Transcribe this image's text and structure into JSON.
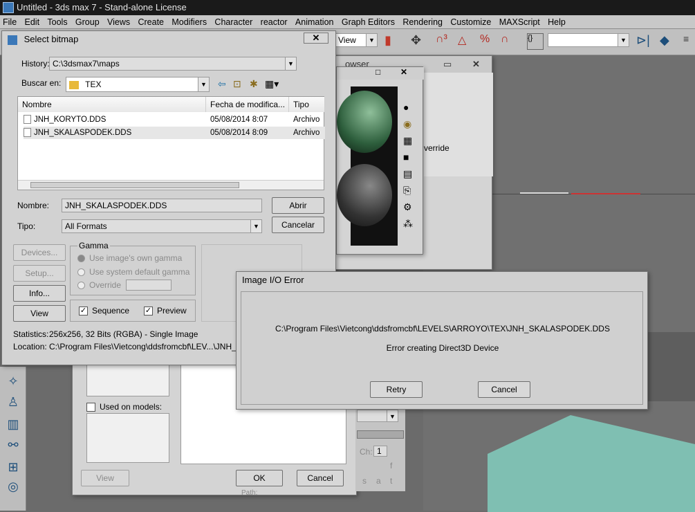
{
  "app": {
    "title": "Untitled - 3ds max 7 - Stand-alone License",
    "menu": [
      "File",
      "Edit",
      "Tools",
      "Group",
      "Views",
      "Create",
      "Modifiers",
      "Character",
      "reactor",
      "Animation",
      "Graph Editors",
      "Rendering",
      "Customize",
      "MAXScript",
      "Help"
    ],
    "toolbar_view_label": "View"
  },
  "select_bitmap": {
    "title": "Select bitmap",
    "history_label": "History:",
    "history_value": "C:\\3dsmax7\\maps",
    "lookin_label": "Buscar en:",
    "lookin_value": "TEX",
    "columns": [
      "Nombre",
      "Fecha de modifica...",
      "Tipo"
    ],
    "files": [
      {
        "name": "JNH_KORYTO.DDS",
        "date": "05/08/2014 8:07",
        "type": "Archivo"
      },
      {
        "name": "JNH_SKALASPODEK.DDS",
        "date": "05/08/2014 8:09",
        "type": "Archivo"
      }
    ],
    "name_label": "Nombre:",
    "name_value": "JNH_SKALASPODEK.DDS",
    "type_label": "Tipo:",
    "type_value": "All Formats",
    "open_button": "Abrir",
    "cancel_button": "Cancelar",
    "devices_button": "Devices...",
    "setup_button": "Setup...",
    "info_button": "Info...",
    "view_button": "View",
    "gamma_title": "Gamma",
    "gamma_own": "Use image's own gamma",
    "gamma_default": "Use system default gamma",
    "gamma_override": "Override",
    "sequence_label": "Sequence",
    "preview_label": "Preview",
    "statistics_label": "Statistics:",
    "statistics_value": "256x256, 32 Bits (RGBA) - Single Image",
    "location_label": "Location:",
    "location_value": "C:\\Program Files\\Vietcong\\ddsfromcbf\\LEV...\\JNH_SKAL"
  },
  "browser": {
    "title_fragment": "owser",
    "override_label": "verride"
  },
  "lower_dialog": {
    "used_on_models": "Used on models:",
    "view_button": "View",
    "ok_button": "OK",
    "cancel_button": "Cancel",
    "ch_label": "Ch:",
    "ch_value": "1",
    "letters": [
      "f",
      "s",
      "a",
      "t"
    ],
    "path_fragment": "Path:"
  },
  "error_dialog": {
    "title": "Image I/O Error",
    "path": "C:\\Program Files\\Vietcong\\ddsfromcbf\\LEVELS\\ARROYO\\TEX\\JNH_SKALASPODEK.DDS",
    "message": "Error creating Direct3D Device",
    "retry_button": "Retry",
    "cancel_button": "Cancel"
  }
}
